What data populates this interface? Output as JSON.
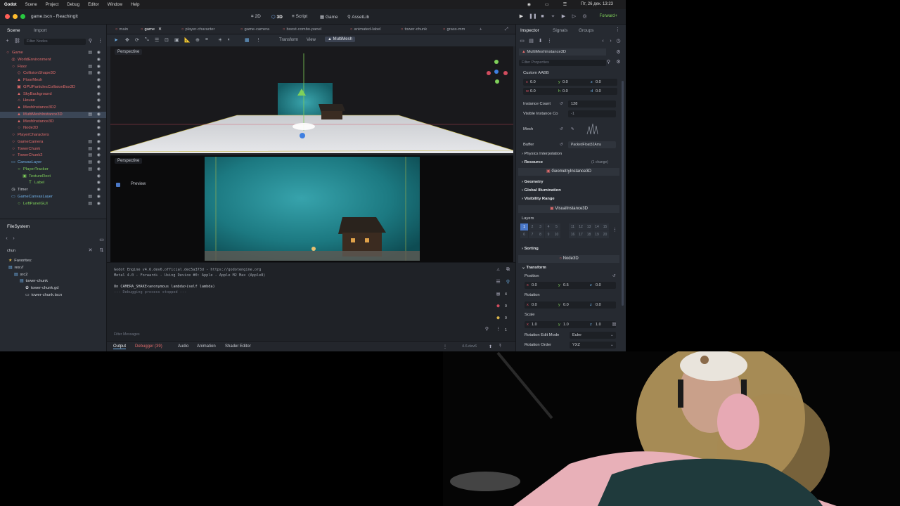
{
  "menubar": {
    "app": "Godot",
    "items": [
      "Scene",
      "Project",
      "Debug",
      "Editor",
      "Window",
      "Help"
    ],
    "clock": "Пт, 26 дек. 13:23"
  },
  "titlebar": {
    "title": "game.tscn - ReachingIt",
    "workspaces": [
      "2D",
      "3D",
      "Script",
      "Game",
      "AssetLib"
    ],
    "renderer": "Forward+"
  },
  "scene_dock": {
    "tabs": [
      "Scene",
      "Import"
    ],
    "filter_placeholder": "Filter Nodes",
    "nodes": [
      {
        "label": "Game",
        "icon": "○",
        "color": "#e06c6c",
        "indent": 0
      },
      {
        "label": "WorldEnvironment",
        "icon": "◎",
        "color": "#e06c6c",
        "indent": 1
      },
      {
        "label": "Floor",
        "icon": "○",
        "color": "#e06c6c",
        "indent": 1
      },
      {
        "label": "CollisionShape3D",
        "icon": "◇",
        "color": "#e06c6c",
        "indent": 2
      },
      {
        "label": "FloorMesh",
        "icon": "▲",
        "color": "#e06c6c",
        "indent": 2
      },
      {
        "label": "GPUParticlesCollisionBox3D",
        "icon": "▣",
        "color": "#e06c6c",
        "indent": 2
      },
      {
        "label": "SkyBackground",
        "icon": "▲",
        "color": "#e06c6c",
        "indent": 2
      },
      {
        "label": "House",
        "icon": "⌂",
        "color": "#e06c6c",
        "indent": 2
      },
      {
        "label": "MeshInstance3D2",
        "icon": "▲",
        "color": "#e06c6c",
        "indent": 2
      },
      {
        "label": "MultiMeshInstance3D",
        "icon": "▲",
        "color": "#e06c6c",
        "indent": 2
      },
      {
        "label": "MeshInstance3D",
        "icon": "▲",
        "color": "#e06c6c",
        "indent": 2
      },
      {
        "label": "Node3D",
        "icon": "○",
        "color": "#e06c6c",
        "indent": 2
      },
      {
        "label": "PlayerCharacters",
        "icon": "○",
        "color": "#e06c6c",
        "indent": 1
      },
      {
        "label": "GameCamera",
        "icon": "○",
        "color": "#e06c6c",
        "indent": 1
      },
      {
        "label": "TowerChunk",
        "icon": "○",
        "color": "#e06c6c",
        "indent": 1
      },
      {
        "label": "TowerChunk2",
        "icon": "○",
        "color": "#e06c6c",
        "indent": 1
      },
      {
        "label": "CanvasLayer",
        "icon": "▭",
        "color": "#6fb0e8",
        "indent": 1
      },
      {
        "label": "PlayerTracker",
        "icon": "○",
        "color": "#7fd05a",
        "indent": 2
      },
      {
        "label": "TextureRect",
        "icon": "▣",
        "color": "#7fd05a",
        "indent": 3
      },
      {
        "label": "Label",
        "icon": "T",
        "color": "#7fd05a",
        "indent": 4
      },
      {
        "label": "Timer",
        "icon": "◷",
        "color": "#cfd2d8",
        "indent": 1
      },
      {
        "label": "GameCanvasLayer",
        "icon": "▭",
        "color": "#6fb0e8",
        "indent": 1
      },
      {
        "label": "LeftPanelGUI",
        "icon": "○",
        "color": "#7fd05a",
        "indent": 2
      }
    ],
    "selected_index": 9
  },
  "filesystem": {
    "title": "FileSystem",
    "search": "chun",
    "items": [
      {
        "label": "Favorites:",
        "icon": "★",
        "color": "#d9b44a",
        "indent": 0
      },
      {
        "label": "res://",
        "icon": "▤",
        "color": "#6fb0e8",
        "indent": 0
      },
      {
        "label": "src2",
        "icon": "▤",
        "color": "#6fb0e8",
        "indent": 1
      },
      {
        "label": "tower-chunk",
        "icon": "▤",
        "color": "#6fb0e8",
        "indent": 2
      },
      {
        "label": "tower-chunk.gd",
        "icon": "✿",
        "color": "#cfd2d8",
        "indent": 3
      },
      {
        "label": "tower-chunk.tscn",
        "icon": "▭",
        "color": "#cfd2d8",
        "indent": 3
      }
    ]
  },
  "scene_tabs": [
    "main",
    "game",
    "player-character",
    "game-camera",
    "boost-combo-panel",
    "animated-label",
    "tower-chunk",
    "grass-mm"
  ],
  "active_scene_tab": 1,
  "viewport_toolbar": {
    "transform": "Transform",
    "view": "View",
    "multimesh": "MultiMesh"
  },
  "viewport": {
    "perspective_label": "Perspective",
    "preview_label": "Preview"
  },
  "console": {
    "lines": [
      "Godot Engine v4.6.dev6.official.dec5a373d - https://godotengine.org",
      "Metal 4.0 - Forward+ - Using Device #0: Apple - Apple M2 Max (Apple8)",
      "",
      "On CAMERA_SHAKE<anonymous lambda>(self lambda)",
      "--- Debugging process stopped ---"
    ],
    "filter_placeholder": "Filter Messages",
    "counts": [
      "4",
      "0",
      "0",
      "1"
    ]
  },
  "bottom_tabs": [
    "Output",
    "Debugger (39)",
    "Audio",
    "Animation",
    "Shader Editor"
  ],
  "version": "4.6.dev6",
  "inspector": {
    "tabs": [
      "Inspector",
      "Signals",
      "Groups"
    ],
    "node_name": "MultiMeshInstance3D",
    "filter_placeholder": "Filter Properties",
    "custom_aabb": "Custom AABB",
    "aabb_row1": [
      "0.0",
      "0.0",
      "0.0"
    ],
    "aabb_row2": [
      "0.0",
      "0.0",
      "0.0"
    ],
    "instance_count_label": "Instance Count",
    "instance_count": "128",
    "visible_instance_label": "Visible Instance Co",
    "visible_instance": "-1",
    "mesh_label": "Mesh",
    "buffer_label": "Buffer",
    "buffer_value": "PackedFloat32Arra",
    "physics_interp": "Physics Interpolation",
    "resource": "Resource",
    "resource_changes": "(1 change)",
    "geometry_banner": "GeometryInstance3D",
    "geometry": "Geometry",
    "global_illum": "Global Illumination",
    "visibility_range": "Visibility Range",
    "visual_banner": "VisualInstance3D",
    "layers_label": "Layers",
    "layers_top": [
      "1",
      "2",
      "3",
      "4",
      "5",
      "",
      "11",
      "12",
      "13",
      "14",
      "15"
    ],
    "layers_bottom": [
      "6",
      "7",
      "8",
      "9",
      "10",
      "",
      "16",
      "17",
      "18",
      "19",
      "20"
    ],
    "sorting": "Sorting",
    "node3d_banner": "Node3D",
    "transform": "Transform",
    "position_label": "Position",
    "position": [
      "0.0",
      "0.5",
      "0.0"
    ],
    "rotation_label": "Rotation",
    "rotation": [
      "0.0",
      "0.0",
      "0.0"
    ],
    "scale_label": "Scale",
    "scale": [
      "1.0",
      "1.0",
      "1.0"
    ],
    "rot_edit_label": "Rotation Edit Mode",
    "rot_edit_value": "Euler",
    "rot_order_label": "Rotation Order",
    "rot_order_value": "YXZ"
  }
}
